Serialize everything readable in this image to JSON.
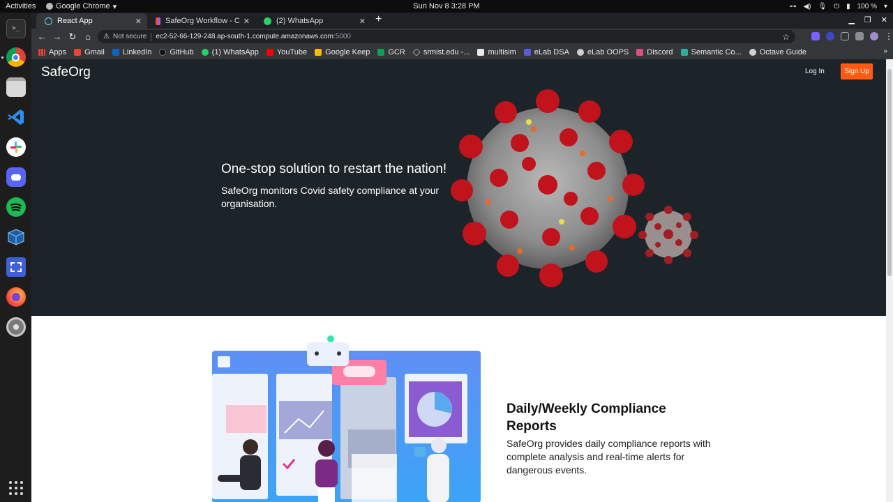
{
  "system": {
    "activities_label": "Activities",
    "app_name": "Google Chrome",
    "clock": "Sun Nov 8   3:28 PM",
    "battery": "100 %"
  },
  "dock": {
    "items": [
      "terminal",
      "chrome",
      "files",
      "vscode",
      "slack",
      "discord",
      "spotify",
      "virtualbox",
      "screenshot",
      "firefox",
      "settings"
    ]
  },
  "browser": {
    "tabs": [
      {
        "title": "React App",
        "active": true
      },
      {
        "title": "SafeOrg Workflow - Cre",
        "active": false
      },
      {
        "title": "(2) WhatsApp",
        "active": false
      }
    ],
    "url": {
      "security_label": "Not secure",
      "host": "ec2-52-66-129-248.ap-south-1.compute.amazonaws.com",
      "port": ":5000"
    },
    "bookmarks": [
      "Apps",
      "Gmail",
      "LinkedIn",
      "GitHub",
      "(1) WhatsApp",
      "YouTube",
      "Google Keep",
      "GCR",
      "srmist.edu -...",
      "multisim",
      "eLab DSA",
      "eLab OOPS",
      "Discord",
      "Semantic Co...",
      "Octave Guide"
    ]
  },
  "page": {
    "brand": "SafeOrg",
    "nav": {
      "login": "Log In",
      "signup": "Sign Up"
    },
    "hero": {
      "headline": "One-stop solution to restart the nation!",
      "subtext": "SafeOrg monitors Covid safety compliance at your organisation."
    },
    "feature": {
      "heading": "Daily/Weekly Compliance Reports",
      "text": "SafeOrg provides daily compliance reports with complete analysis and real-time alerts for dangerous events."
    }
  },
  "colors": {
    "hero_bg": "#1c2429",
    "signup_bg": "#ff5a0f",
    "virus_red": "#c0131b",
    "virus_core": "#8e8e8e"
  }
}
